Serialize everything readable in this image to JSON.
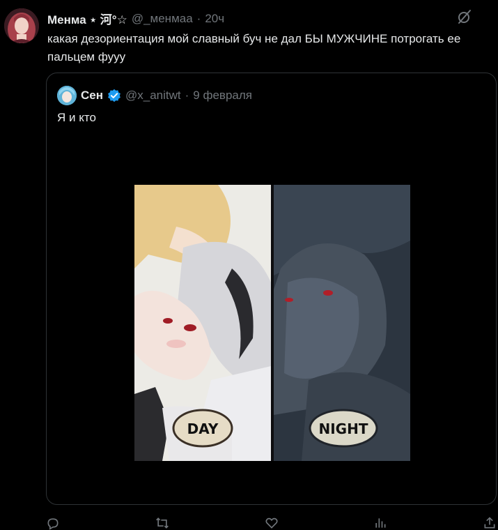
{
  "tweet": {
    "author_name": "Менма ⋆ 河°☆",
    "author_handle": "@_менмаа",
    "separator": "·",
    "time": "20ч",
    "text": "какая дезориентация мой славный буч не дал БЫ МУЖЧИНЕ потрогать ее пальцем фууу"
  },
  "quote": {
    "author_name": "Сен",
    "author_handle": "@x_anitwt",
    "separator": "·",
    "date": "9 февраля",
    "text": "Я и кто",
    "media": {
      "left_label": "DAY",
      "right_label": "NIGHT"
    }
  },
  "icons": {
    "grok": "grok-icon",
    "verified": "verified-badge-icon",
    "actions": [
      "reply-icon",
      "retweet-icon",
      "like-icon",
      "views-icon",
      "share-icon"
    ]
  },
  "colors": {
    "background": "#000000",
    "text": "#e7e9ea",
    "muted": "#71767b",
    "border": "#2f3336",
    "verified": "#1d9bf0"
  }
}
